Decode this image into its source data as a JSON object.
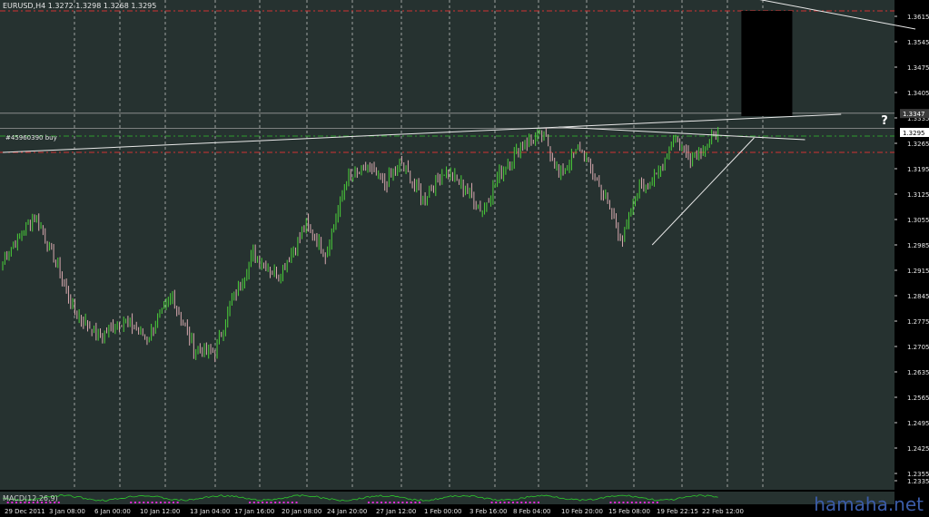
{
  "header": {
    "symbol_line": "EURUSD,H4  1.3272 1.3298 1.3268 1.3295"
  },
  "indicator_label": "MACD(12,26,9)",
  "watermark": "hamaha.net",
  "colors": {
    "background": "#000000",
    "plot_bg": "#263230",
    "bull": "#4bd13a",
    "bear": "#d8aab0",
    "grid": "#d0d0d0",
    "red_line": "#d23232",
    "green_line": "#2e9c2e",
    "trend": "#e8e8e8",
    "rect": "#000000",
    "indicator_line": "#2cc92c",
    "indicator_bar": "#e22bd8",
    "watermark": "#3b5ca8"
  },
  "chart_data": {
    "type": "candlestick",
    "symbol": "EURUSD",
    "timeframe": "H4",
    "last_bar": {
      "open": 1.3272,
      "high": 1.3298,
      "low": 1.3268,
      "close": 1.3295
    },
    "ylim": [
      1.231,
      1.366
    ],
    "y_ticks": [
      "1.3615",
      "1.3545",
      "1.3475",
      "1.3405",
      "1.3335",
      "1.3265",
      "1.3195",
      "1.3125",
      "1.3055",
      "1.2985",
      "1.2915",
      "1.2845",
      "1.2775",
      "1.2705",
      "1.2635",
      "1.2565",
      "1.2495",
      "1.2425",
      "1.2355",
      "1.2335"
    ],
    "x_ticks": [
      "29 Dec 2011",
      "3 Jan 08:00",
      "6 Jan 00:00",
      "10 Jan 12:00",
      "13 Jan 04:00",
      "17 Jan 16:00",
      "20 Jan 08:00",
      "24 Jan 20:00",
      "27 Jan 12:00",
      "1 Feb 00:00",
      "3 Feb 16:00",
      "8 Feb 04:00",
      "10 Feb 20:00",
      "15 Feb 08:00",
      "19 Feb 22:15",
      "22 Feb 12:00"
    ],
    "price_labels": [
      {
        "price": 1.3347,
        "text": "1.3347"
      },
      {
        "price": 1.3295,
        "text": "1.3295"
      }
    ],
    "order_label": "#45960390 buy",
    "question_mark": "?",
    "red_levels": [
      1.363,
      1.324
    ],
    "green_level": 1.3285,
    "white_levels": [
      1.3348,
      1.3306
    ],
    "pivots": [
      {
        "bar": 0,
        "close": 1.294
      },
      {
        "bar": 15,
        "close": 1.307
      },
      {
        "bar": 24,
        "close": 1.295
      },
      {
        "bar": 34,
        "close": 1.28
      },
      {
        "bar": 46,
        "close": 1.273
      },
      {
        "bar": 56,
        "close": 1.278
      },
      {
        "bar": 68,
        "close": 1.273
      },
      {
        "bar": 80,
        "close": 1.284
      },
      {
        "bar": 90,
        "close": 1.27
      },
      {
        "bar": 100,
        "close": 1.269
      },
      {
        "bar": 108,
        "close": 1.283
      },
      {
        "bar": 118,
        "close": 1.296
      },
      {
        "bar": 130,
        "close": 1.29
      },
      {
        "bar": 143,
        "close": 1.304
      },
      {
        "bar": 152,
        "close": 1.296
      },
      {
        "bar": 162,
        "close": 1.316
      },
      {
        "bar": 172,
        "close": 1.32
      },
      {
        "bar": 180,
        "close": 1.315
      },
      {
        "bar": 188,
        "close": 1.321
      },
      {
        "bar": 198,
        "close": 1.311
      },
      {
        "bar": 208,
        "close": 1.319
      },
      {
        "bar": 218,
        "close": 1.314
      },
      {
        "bar": 226,
        "close": 1.308
      },
      {
        "bar": 234,
        "close": 1.318
      },
      {
        "bar": 246,
        "close": 1.327
      },
      {
        "bar": 256,
        "close": 1.328
      },
      {
        "bar": 262,
        "close": 1.318
      },
      {
        "bar": 272,
        "close": 1.325
      },
      {
        "bar": 281,
        "close": 1.315
      },
      {
        "bar": 292,
        "close": 1.3
      },
      {
        "bar": 300,
        "close": 1.315
      },
      {
        "bar": 308,
        "close": 1.317
      },
      {
        "bar": 316,
        "close": 1.328
      },
      {
        "bar": 324,
        "close": 1.323
      },
      {
        "bar": 333,
        "close": 1.327
      },
      {
        "bar": 337,
        "close": 1.3295
      }
    ],
    "trendlines": [
      {
        "from": [
          0,
          1.324
        ],
        "to": [
          395,
          1.3345
        ]
      },
      {
        "from": [
          262,
          1.331
        ],
        "to": [
          378,
          1.3275
        ]
      },
      {
        "from": [
          306,
          1.2985
        ],
        "to": [
          354,
          1.328
        ]
      },
      {
        "from": [
          308,
          1.3715
        ],
        "to": [
          430,
          1.358
        ]
      }
    ],
    "target_zone": {
      "from_bar": 348,
      "to_bar": 372,
      "top": 1.363,
      "bottom": 1.334
    },
    "grid": true
  }
}
